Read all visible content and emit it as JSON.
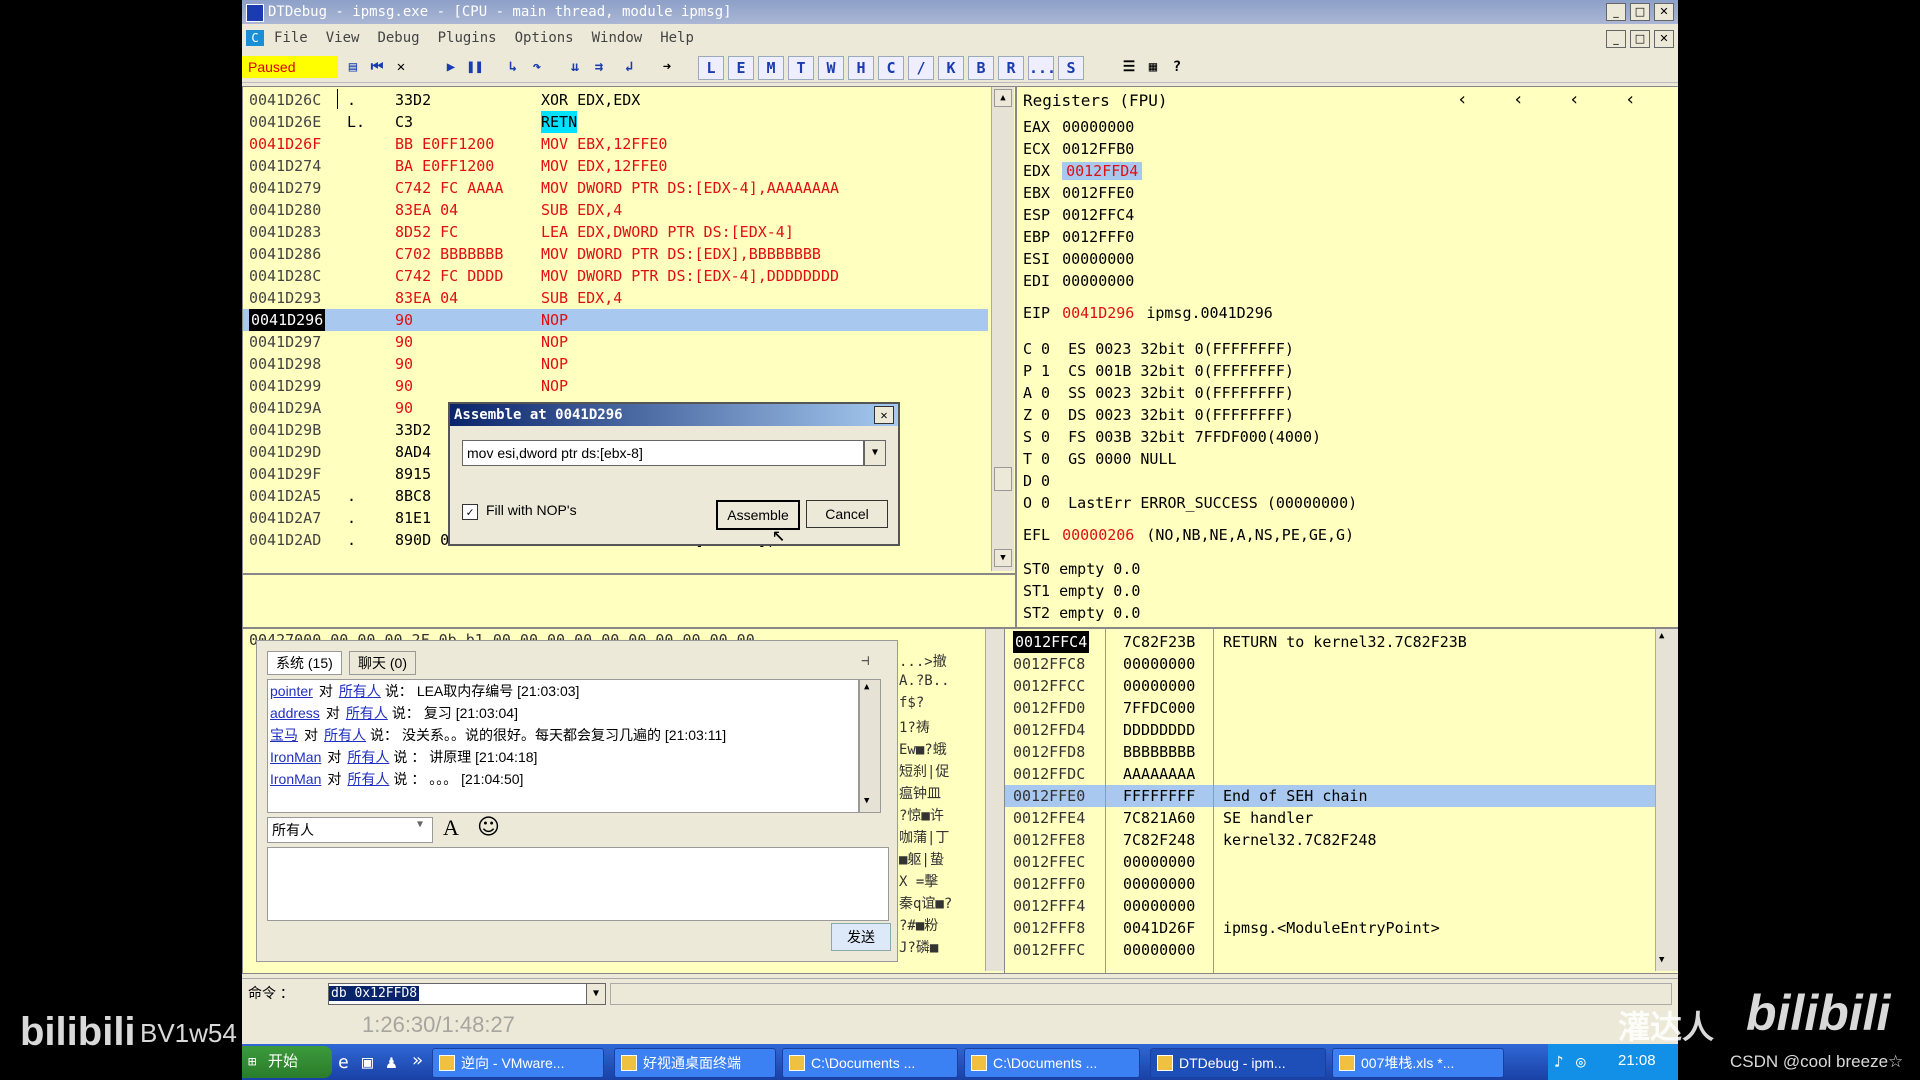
{
  "window": {
    "title": "DTDebug - ipmsg.exe - [CPU - main thread, module ipmsg]"
  },
  "menu": [
    "File",
    "View",
    "Debug",
    "Plugins",
    "Options",
    "Window",
    "Help"
  ],
  "toolbar": {
    "status": "Paused",
    "letters": [
      "L",
      "E",
      "M",
      "T",
      "W",
      "H",
      "C",
      "/",
      "K",
      "B",
      "R",
      "...",
      "S"
    ]
  },
  "cpu": {
    "rows": [
      {
        "addr": "0041D26C",
        "mark": ".",
        "hex": "33D2",
        "dis": "XOR EDX,EDX"
      },
      {
        "addr": "0041D26E",
        "mark": "L.",
        "hex": "C3",
        "dis": "RETN"
      },
      {
        "addr": "0041D26F",
        "mark": "",
        "hex": "BB E0FF1200",
        "dis": "MOV EBX,12FFE0"
      },
      {
        "addr": "0041D274",
        "mark": "",
        "hex": "BA E0FF1200",
        "dis": "MOV EDX,12FFE0"
      },
      {
        "addr": "0041D279",
        "mark": "",
        "hex": "C742 FC AAAA",
        "dis": "MOV DWORD PTR DS:[EDX-4],AAAAAAAA"
      },
      {
        "addr": "0041D280",
        "mark": "",
        "hex": "83EA 04",
        "dis": "SUB EDX,4"
      },
      {
        "addr": "0041D283",
        "mark": "",
        "hex": "8D52 FC",
        "dis": "LEA EDX,DWORD PTR DS:[EDX-4]"
      },
      {
        "addr": "0041D286",
        "mark": "",
        "hex": "C702 BBBBBBB",
        "dis": "MOV DWORD PTR DS:[EDX],BBBBBBBB"
      },
      {
        "addr": "0041D28C",
        "mark": "",
        "hex": "C742 FC DDDD",
        "dis": "MOV DWORD PTR DS:[EDX-4],DDDDDDDD"
      },
      {
        "addr": "0041D293",
        "mark": "",
        "hex": "83EA 04",
        "dis": "SUB EDX,4"
      },
      {
        "addr": "0041D296",
        "mark": "",
        "hex": "90",
        "dis": "NOP"
      },
      {
        "addr": "0041D297",
        "mark": "",
        "hex": "90",
        "dis": "NOP"
      },
      {
        "addr": "0041D298",
        "mark": "",
        "hex": "90",
        "dis": "NOP"
      },
      {
        "addr": "0041D299",
        "mark": "",
        "hex": "90",
        "dis": "NOP"
      },
      {
        "addr": "0041D29A",
        "mark": "",
        "hex": "90",
        "dis": ""
      },
      {
        "addr": "0041D29B",
        "mark": "",
        "hex": "33D2",
        "dis": ""
      },
      {
        "addr": "0041D29D",
        "mark": "",
        "hex": "8AD4",
        "dis": ""
      },
      {
        "addr": "0041D29F",
        "mark": "",
        "hex": "8915",
        "dis": ""
      },
      {
        "addr": "0041D2A5",
        "mark": ".",
        "hex": "8BC8",
        "dis": ""
      },
      {
        "addr": "0041D2A7",
        "mark": ".",
        "hex": "81E1",
        "dis": ""
      },
      {
        "addr": "0041D2AD",
        "mark": ".",
        "hex": "890D 0CE3420",
        "dis": "MOV DWORD PTR DS:[42E30C],ECX"
      }
    ]
  },
  "registers": {
    "header": "Registers (FPU)",
    "general": [
      {
        "name": "EAX",
        "value": "00000000"
      },
      {
        "name": "ECX",
        "value": "0012FFB0"
      },
      {
        "name": "EDX",
        "value": "0012FFD4"
      },
      {
        "name": "EBX",
        "value": "0012FFE0"
      },
      {
        "name": "ESP",
        "value": "0012FFC4"
      },
      {
        "name": "EBP",
        "value": "0012FFF0"
      },
      {
        "name": "ESI",
        "value": "00000000"
      },
      {
        "name": "EDI",
        "value": "00000000"
      }
    ],
    "eip": {
      "name": "EIP",
      "value": "0041D296",
      "comment": "ipmsg.0041D296"
    },
    "flags": [
      "C 0  ES 0023 32bit 0(FFFFFFFF)",
      "P 1  CS 001B 32bit 0(FFFFFFFF)",
      "A 0  SS 0023 32bit 0(FFFFFFFF)",
      "Z 0  DS 0023 32bit 0(FFFFFFFF)",
      "S 0  FS 003B 32bit 7FFDF000(4000)",
      "T 0  GS 0000 NULL",
      "D 0",
      "O 0  LastErr ERROR_SUCCESS (00000000)"
    ],
    "efl": {
      "name": "EFL",
      "value": "00000206",
      "comment": "(NO,NB,NE,A,NS,PE,GE,G)"
    },
    "fpu": [
      "ST0 empty 0.0",
      "ST1 empty 0.0",
      "ST2 empty 0.0"
    ]
  },
  "stack": {
    "rows": [
      {
        "addr": "0012FFC4",
        "value": "7C82F23B",
        "comment": "RETURN to kernel32.7C82F23B"
      },
      {
        "addr": "0012FFC8",
        "value": "00000000",
        "comment": ""
      },
      {
        "addr": "0012FFCC",
        "value": "00000000",
        "comment": ""
      },
      {
        "addr": "0012FFD0",
        "value": "7FFDC000",
        "comment": ""
      },
      {
        "addr": "0012FFD4",
        "value": "DDDDDDDD",
        "comment": ""
      },
      {
        "addr": "0012FFD8",
        "value": "BBBBBBBB",
        "comment": ""
      },
      {
        "addr": "0012FFDC",
        "value": "AAAAAAAA",
        "comment": ""
      },
      {
        "addr": "0012FFE0",
        "value": "FFFFFFFF",
        "comment": "End of SEH chain"
      },
      {
        "addr": "0012FFE4",
        "value": "7C821A60",
        "comment": "SE handler"
      },
      {
        "addr": "0012FFE8",
        "value": "7C82F248",
        "comment": "kernel32.7C82F248"
      },
      {
        "addr": "0012FFEC",
        "value": "00000000",
        "comment": ""
      },
      {
        "addr": "0012FFF0",
        "value": "00000000",
        "comment": ""
      },
      {
        "addr": "0012FFF4",
        "value": "00000000",
        "comment": ""
      },
      {
        "addr": "0012FFF8",
        "value": "0041D26F",
        "comment": "ipmsg.<ModuleEntryPoint>"
      },
      {
        "addr": "0012FFFC",
        "value": "00000000",
        "comment": ""
      }
    ]
  },
  "dump": {
    "top_line": "00427000 00 00 00 2F 0b b1 00 00 00 00 00 00 00 00 00 00",
    "right_chars": [
      "...>撤",
      "A.?B..",
      "f$?",
      "1?祷",
      "Ew■?蛾",
      "短刹|促",
      "瘟钟皿",
      "?惊■许",
      "咖蒲|丁",
      "■躯|蛰",
      "X =擊",
      "秦q谊■?",
      "?#■粉",
      "J?磷■"
    ]
  },
  "chat": {
    "tabs": [
      "系统 (15)",
      "聊天 (0)"
    ],
    "messages": [
      {
        "user": "pointer",
        "to": "对",
        "target": "所有人",
        "say": "说：",
        "text": "LEA取内存编号 [21:03:03]"
      },
      {
        "user": "address",
        "to": "对",
        "target": "所有人",
        "say": "说：",
        "text": "复习 [21:03:04]"
      },
      {
        "user": "宝马",
        "to": "对",
        "target": "所有人",
        "say": "说：",
        "text": "没关系。。说的很好。每天都会复习几遍的 [21:03:11]"
      },
      {
        "user": "IronMan",
        "to": "对",
        "target": "所有人",
        "say": "说",
        "text": "： 讲原理 [21:04:18]"
      },
      {
        "user": "IronMan",
        "to": "对",
        "target": "所有人",
        "say": "说",
        "text": "： 。。。 [21:04:50]"
      }
    ],
    "recipient": "所有人",
    "send_label": "发送"
  },
  "dialog": {
    "title": "Assemble at 0041D296",
    "input_value": "mov esi,dword ptr ds:[ebx-8]",
    "checkbox_label": "Fill with NOP's",
    "assemble_label": "Assemble",
    "cancel_label": "Cancel"
  },
  "command": {
    "label": "命令 ：",
    "value": "db 0x12FFD8"
  },
  "taskbar": {
    "start": "开始",
    "tasks": [
      "逆向 - VMware...",
      "好视通桌面终端",
      "C:\\Documents ...",
      "C:\\Documents ...",
      "DTDebug - ipm...",
      "007堆栈.xls *..."
    ],
    "clock": "21:08"
  },
  "overlay": {
    "bvid": "BV1w54",
    "timecode": "1:26:30/1:48:27",
    "uploader": "灌达人",
    "logo": "bilibili",
    "credit": "CSDN @cool breeze☆"
  },
  "colors": {
    "pane_bg": "#ffffc0",
    "red_text": "#e01010",
    "selection": "#a8c8f0",
    "titlebar": "#0a246a"
  }
}
